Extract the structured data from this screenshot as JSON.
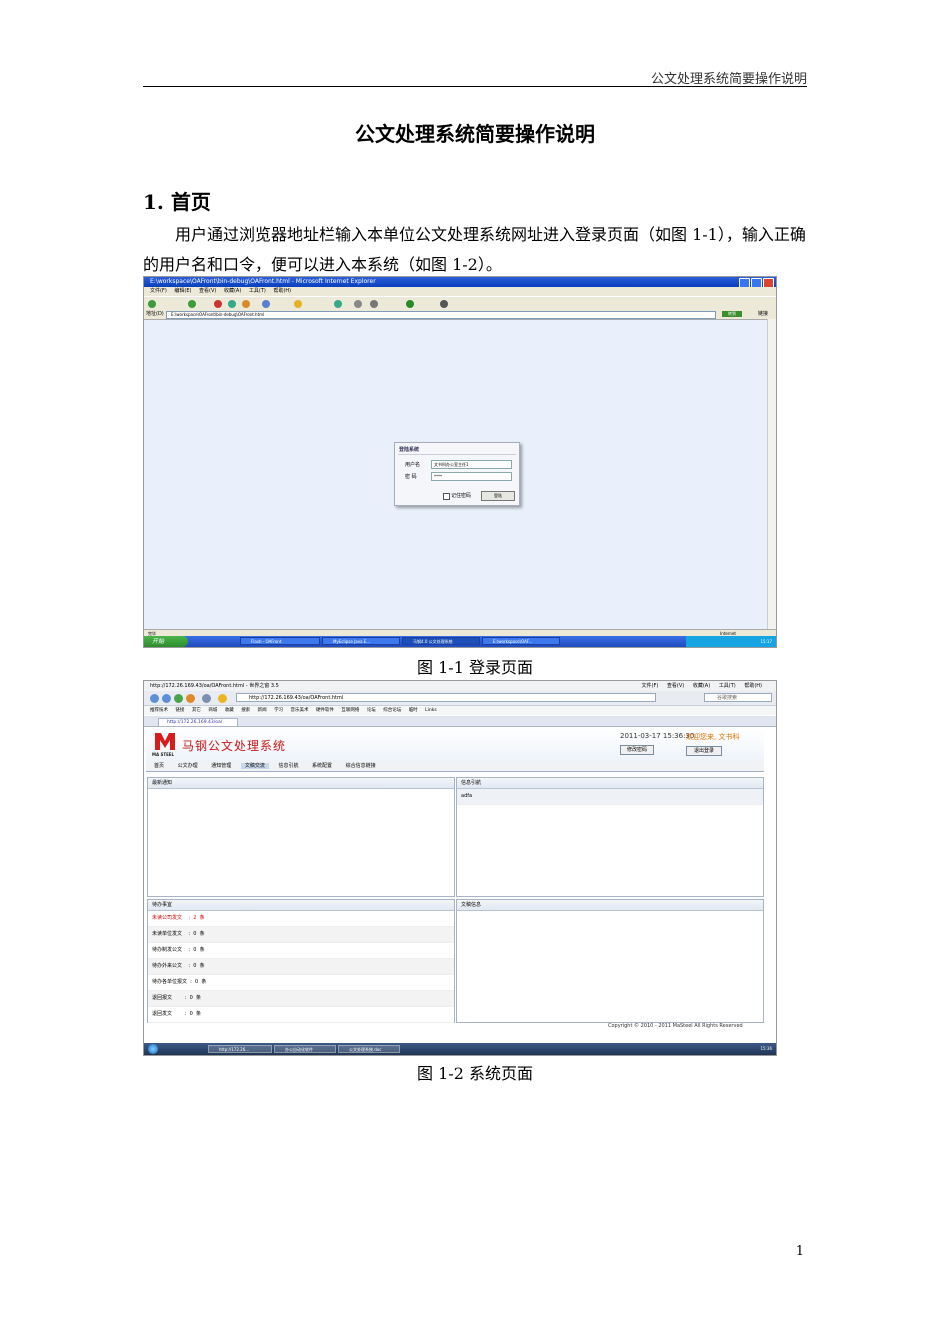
{
  "header": {
    "running_title": "公文处理系统简要操作说明",
    "page_number": "1"
  },
  "doc": {
    "title": "公文处理系统简要操作说明",
    "section_1": "1. 首页",
    "paragraph": "用户通过浏览器地址栏输入本单位公文处理系统网址进入登录页面（如图 1-1），输入正确的用户名和口令，便可以进入本系统（如图 1-2）。",
    "caption_1": "图 1-1 登录页面",
    "caption_2": "图 1-2 系统页面"
  },
  "fig1": {
    "window_title": "E:\\workspace\\OAFront\\bin-debug\\OAFront.html - Microsoft Internet Explorer",
    "menu": [
      "文件(F)",
      "编辑(E)",
      "查看(V)",
      "收藏(A)",
      "工具(T)",
      "帮助(H)"
    ],
    "address_label": "地址(D)",
    "address": "E:\\workspace\\OAFront\\bin-debug\\OAFront.html",
    "go": "转到",
    "links": "链接",
    "login_title": "登陆系统",
    "username_label": "用户名",
    "username_value": "文书科办公室主任1",
    "password_label": "密 码",
    "password_value": "****",
    "remember_label": "记住密码",
    "login_button": "登陆",
    "status_left": "完毕",
    "status_zone": "Internet",
    "start_label": "开始",
    "taskbar": [
      "Flash - OAFront",
      "MyEclipse Java E...",
      "马钢4.0 公文处理系统",
      "E:\\workspace\\OAF..."
    ],
    "clock": "15:17"
  },
  "fig2": {
    "window_title": "http://172.26.169.43/oa/OAFront.html - 世界之窗 3.5",
    "menu": [
      "文件(F)",
      "查看(V)",
      "收藏(A)",
      "工具(T)",
      "帮助(H)"
    ],
    "url": "http://172.26.169.43/oa/OAFront.html",
    "search_placeholder": "谷歌搜索",
    "favorites": [
      "推荐技术",
      "链接",
      "其它",
      "商城",
      "收藏",
      "搜索",
      "新闻",
      "学习",
      "音乐美术",
      "硬件软件",
      "互联网络",
      "论坛",
      "综合论坛",
      "临时",
      "Links"
    ],
    "tab": "http://172.26.169.43/oa/",
    "logo_text": "MA STEEL",
    "app_name": "马钢公文处理系统",
    "datetime": "2011-03-17 15:36:30",
    "welcome": "欢迎您来, 文书科",
    "change_password": "修改密码",
    "logout": "退出登录",
    "nav_tabs": [
      "首页",
      "公文办理",
      "通知管理",
      "文稿交流",
      "信息引航",
      "系统配置",
      "综合信息链接"
    ],
    "active_tab_index": 3,
    "panel_notice": "最新通知",
    "panel_guide": "信息引航",
    "guide_item": "adfa",
    "panel_todo": "待办事宜",
    "todo_rows": [
      "未读公司发文    :  2  条",
      "未读单位发文    :  0  条",
      "待办制发公文    :  0  条",
      "待办外来公文    :  0  条",
      "待办各单位报文  :  0  条",
      "退回报文        :  0  条",
      "退回发文        :  0  条"
    ],
    "panel_docs": "文稿信息",
    "copyright": "Copyright © 2010 - 2011 MaSteel All Rights Reserved",
    "taskbar": [
      "http://172.26...",
      "办公自动化软件",
      "公文处理系统.doc"
    ],
    "clock": "15:36"
  }
}
